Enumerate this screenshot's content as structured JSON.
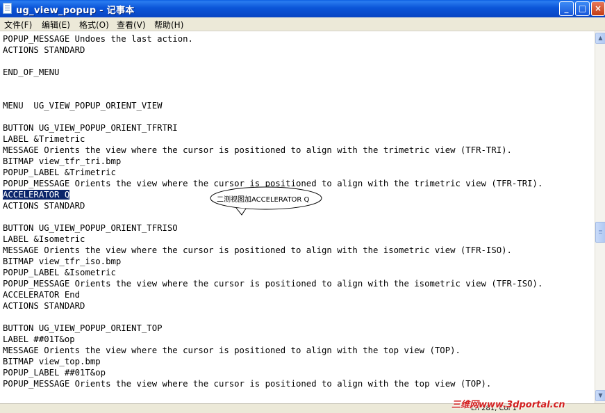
{
  "window": {
    "title": "ug_view_popup - 记事本",
    "buttons": {
      "minimize": "_",
      "maximize": "□",
      "close": "×"
    }
  },
  "menu": {
    "items": [
      {
        "label": "文件(F)"
      },
      {
        "label": "编辑(E)"
      },
      {
        "label": "格式(O)"
      },
      {
        "label": "查看(V)"
      },
      {
        "label": "帮助(H)"
      }
    ]
  },
  "editor": {
    "lines": [
      "POPUP_MESSAGE Undoes the last action.",
      "ACTIONS STANDARD",
      "",
      "END_OF_MENU",
      "",
      "",
      "MENU  UG_VIEW_POPUP_ORIENT_VIEW",
      "",
      "BUTTON UG_VIEW_POPUP_ORIENT_TFRTRI",
      "LABEL &Trimetric",
      "MESSAGE Orients the view where the cursor is positioned to align with the trimetric view (TFR-TRI).",
      "BITMAP view_tfr_tri.bmp",
      "POPUP_LABEL &Trimetric",
      "POPUP_MESSAGE Orients the view where the cursor is positioned to align with the trimetric view (TFR-TRI).",
      "ACCELERATOR Q",
      "ACTIONS STANDARD",
      "",
      "BUTTON UG_VIEW_POPUP_ORIENT_TFRISO",
      "LABEL &Isometric",
      "MESSAGE Orients the view where the cursor is positioned to align with the isometric view (TFR-ISO).",
      "BITMAP view_tfr_iso.bmp",
      "POPUP_LABEL &Isometric",
      "POPUP_MESSAGE Orients the view where the cursor is positioned to align with the isometric view (TFR-ISO).",
      "ACCELERATOR End",
      "ACTIONS STANDARD",
      "",
      "BUTTON UG_VIEW_POPUP_ORIENT_TOP",
      "LABEL ##01T&op",
      "MESSAGE Orients the view where the cursor is positioned to align with the top view (TOP).",
      "BITMAP view_top.bmp",
      "POPUP_LABEL ##01T&op",
      "POPUP_MESSAGE Orients the view where the cursor is positioned to align with the top view (TOP)."
    ],
    "selected_text": "ACCELERATOR Q"
  },
  "annotation": {
    "text": "二测视图加ACCELERATOR Q"
  },
  "status": {
    "position": "Ln 281, Col 1"
  },
  "watermark": {
    "text": "三维网www.3dportal.cn"
  },
  "colors": {
    "title_bar": "#0b55d8",
    "selection": "#0a246a",
    "watermark": "#d21f1f"
  }
}
